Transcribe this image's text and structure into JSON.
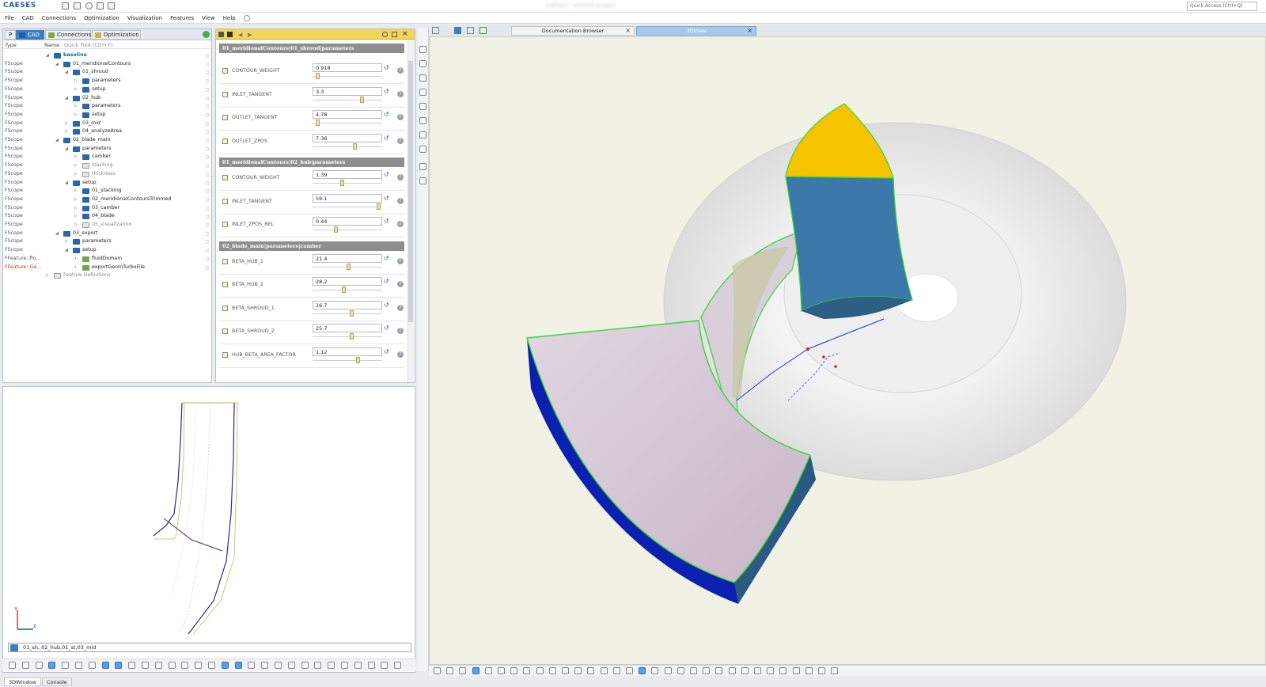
{
  "app": {
    "logo": "CAESES",
    "window_title": "CAESES - untitled project"
  },
  "quick_access": {
    "placeholder": "Quick Access (Ctrl+Q)"
  },
  "menu": [
    "File",
    "CAD",
    "Connections",
    "Optimization",
    "Visualization",
    "Features",
    "View",
    "Help"
  ],
  "left_tabs": {
    "p": "P",
    "cad": "CAD",
    "connections": "Connections",
    "optimization": "Optimization"
  },
  "tree_header": {
    "type": "Type",
    "name": "Name",
    "quick_find": "Quick Find (Ctrl+F)"
  },
  "tree": [
    {
      "type": "",
      "name": "baseline",
      "depth": 0,
      "kind": "root",
      "arrow": "◢"
    },
    {
      "type": "FScope",
      "name": "01_meridionalContours",
      "depth": 1,
      "kind": "folder",
      "arrow": "◢"
    },
    {
      "type": "FScope",
      "name": "01_shroud",
      "depth": 2,
      "kind": "folder",
      "arrow": "◢"
    },
    {
      "type": "FScope",
      "name": "parameters",
      "depth": 3,
      "kind": "folder",
      "arrow": "▷"
    },
    {
      "type": "FScope",
      "name": "setup",
      "depth": 3,
      "kind": "folder",
      "arrow": "▷"
    },
    {
      "type": "FScope",
      "name": "02_hub",
      "depth": 2,
      "kind": "folder",
      "arrow": "◢"
    },
    {
      "type": "FScope",
      "name": "parameters",
      "depth": 3,
      "kind": "folder",
      "arrow": "▷"
    },
    {
      "type": "FScope",
      "name": "setup",
      "depth": 3,
      "kind": "folder",
      "arrow": "▷"
    },
    {
      "type": "FScope",
      "name": "03_mid",
      "depth": 2,
      "kind": "folder",
      "arrow": "▷"
    },
    {
      "type": "FScope",
      "name": "04_analyzeArea",
      "depth": 2,
      "kind": "folder",
      "arrow": "▷"
    },
    {
      "type": "FScope",
      "name": "02_blade_main",
      "depth": 1,
      "kind": "folder",
      "arrow": "◢"
    },
    {
      "type": "FScope",
      "name": "parameters",
      "depth": 2,
      "kind": "folder",
      "arrow": "◢"
    },
    {
      "type": "FScope",
      "name": "camber",
      "depth": 3,
      "kind": "folder",
      "arrow": "▷"
    },
    {
      "type": "FScope",
      "name": "stacking",
      "depth": 3,
      "kind": "grey",
      "arrow": "▷"
    },
    {
      "type": "FScope",
      "name": "thickness",
      "depth": 3,
      "kind": "grey",
      "arrow": "▷"
    },
    {
      "type": "FScope",
      "name": "setup",
      "depth": 2,
      "kind": "folder",
      "arrow": "◢"
    },
    {
      "type": "FScope",
      "name": "01_stacking",
      "depth": 3,
      "kind": "folder",
      "arrow": "▷"
    },
    {
      "type": "FScope",
      "name": "02_meridionalContoursTrimmed",
      "depth": 3,
      "kind": "folder",
      "arrow": "▷"
    },
    {
      "type": "FScope",
      "name": "03_camber",
      "depth": 3,
      "kind": "folder",
      "arrow": "▷"
    },
    {
      "type": "FScope",
      "name": "04_blade",
      "depth": 3,
      "kind": "folder",
      "arrow": "▷"
    },
    {
      "type": "FScope",
      "name": "05_visualization",
      "depth": 3,
      "kind": "grey",
      "arrow": "▷"
    },
    {
      "type": "FScope",
      "name": "03_export",
      "depth": 1,
      "kind": "folder",
      "arrow": "◢"
    },
    {
      "type": "FScope",
      "name": "parameters",
      "depth": 2,
      "kind": "folder",
      "arrow": "▷"
    },
    {
      "type": "FScope",
      "name": "setup",
      "depth": 2,
      "kind": "folder",
      "arrow": "◢"
    },
    {
      "type": "FFeature::flo...",
      "name": "fluidDomain",
      "depth": 3,
      "kind": "feature",
      "arrow": "•"
    },
    {
      "type": "FFeature::Ge...",
      "name": "exportGeomTurboFile",
      "depth": 3,
      "kind": "feature-warn",
      "arrow": "•"
    },
    {
      "type": "",
      "name": "Feature Definitions",
      "depth": 0,
      "kind": "grey",
      "arrow": "▷"
    }
  ],
  "params": {
    "sections": [
      {
        "title": "01_meridionalContours|01_shroud|parameters",
        "rows": [
          {
            "name": "CONTOUR_WEIGHT",
            "value": "0.918",
            "slider": 0.05
          },
          {
            "name": "INLET_TANGENT",
            "value": "3.3",
            "slider": 0.72
          },
          {
            "name": "OUTLET_TANGENT",
            "value": "4.78",
            "slider": 0.05
          },
          {
            "name": "OUTLET_ZPOS",
            "value": "7.36",
            "slider": 0.62
          }
        ]
      },
      {
        "title": "01_meridionalContours|02_hub|parameters",
        "rows": [
          {
            "name": "CONTOUR_WEIGHT",
            "value": "1.39",
            "slider": 0.42
          },
          {
            "name": "INLET_TANGENT",
            "value": "59.1",
            "slider": 0.98
          },
          {
            "name": "INLET_ZPOS_REL",
            "value": "0.44",
            "slider": 0.33
          }
        ]
      },
      {
        "title": "02_blade_main|parameters|camber",
        "rows": [
          {
            "name": "BETA_HUB_1",
            "value": "21.4",
            "slider": 0.52
          },
          {
            "name": "BETA_HUB_2",
            "value": "28.2",
            "slider": 0.44
          },
          {
            "name": "BETA_SHROUD_1",
            "value": "16.7",
            "slider": 0.57
          },
          {
            "name": "BETA_SHROUD_2",
            "value": "25.7",
            "slider": 0.57
          },
          {
            "name": "HUB_BETA_AREA_FACTOR",
            "value": "1.12",
            "slider": 0.66
          }
        ]
      }
    ]
  },
  "command_input": {
    "value": "01_sh, 02_hub,01_st,03_mid"
  },
  "axis_labels": {
    "x": "x",
    "z": "z"
  },
  "bottom_tabs": [
    "3DWindow",
    "Console"
  ],
  "right_tabs": [
    {
      "label": "Documentation Browser",
      "close": "×"
    },
    {
      "label": "3DView",
      "close": "×"
    }
  ],
  "colors": {
    "accent": "#3c7fc1",
    "toolbar_yellow": "#f3d55a",
    "blade_top": "#f5c300",
    "blade_side": "#3c78a8",
    "sector_face": "#d6c8d6",
    "sector_side": "#0b1fb0",
    "edge_green": "#34d634"
  }
}
